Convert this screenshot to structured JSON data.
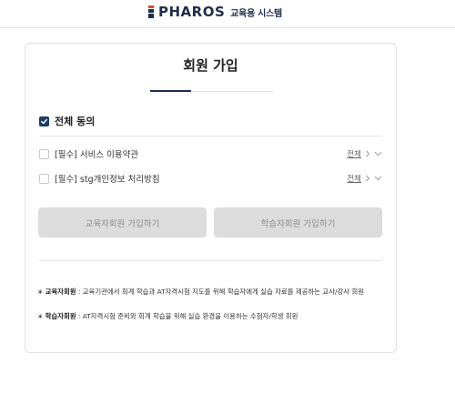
{
  "header": {
    "logo_text": "PHAROS",
    "logo_subtitle": "교육용 시스템"
  },
  "signup": {
    "title": "회원 가입",
    "agree_all_label": "전체 동의",
    "agree_all_checked": true,
    "terms": [
      {
        "label": "[필수] 서비스 이용약관",
        "view_label": "전체",
        "checked": false
      },
      {
        "label": "[필수] stg개인정보 처리방침",
        "view_label": "전체",
        "checked": false
      }
    ],
    "buttons": {
      "educator_signup": "교육자회원 가입하기",
      "learner_signup": "학습자회원 가입하기"
    },
    "notes": [
      {
        "bullet": "∗",
        "term": "교육자회원",
        "text": " : 교육기관에서 회계 학습과 AT자격시험 지도를 위해 학습자에게 실습 자료를 제공하는 교사/강사 회원"
      },
      {
        "bullet": "∗",
        "term": "학습자회원",
        "text": " : AT자격시험 준비와 회계 학습을 위해 실습 환경을 이용하는 수험자/학생 회원"
      }
    ]
  },
  "colors": {
    "brand_navy": "#1f2d4e",
    "logo_accent": "#e04b2b",
    "checkbox_checked": "#1f3a6e",
    "button_disabled_bg": "#dcdcdc",
    "button_disabled_text": "#8c8c8c"
  }
}
